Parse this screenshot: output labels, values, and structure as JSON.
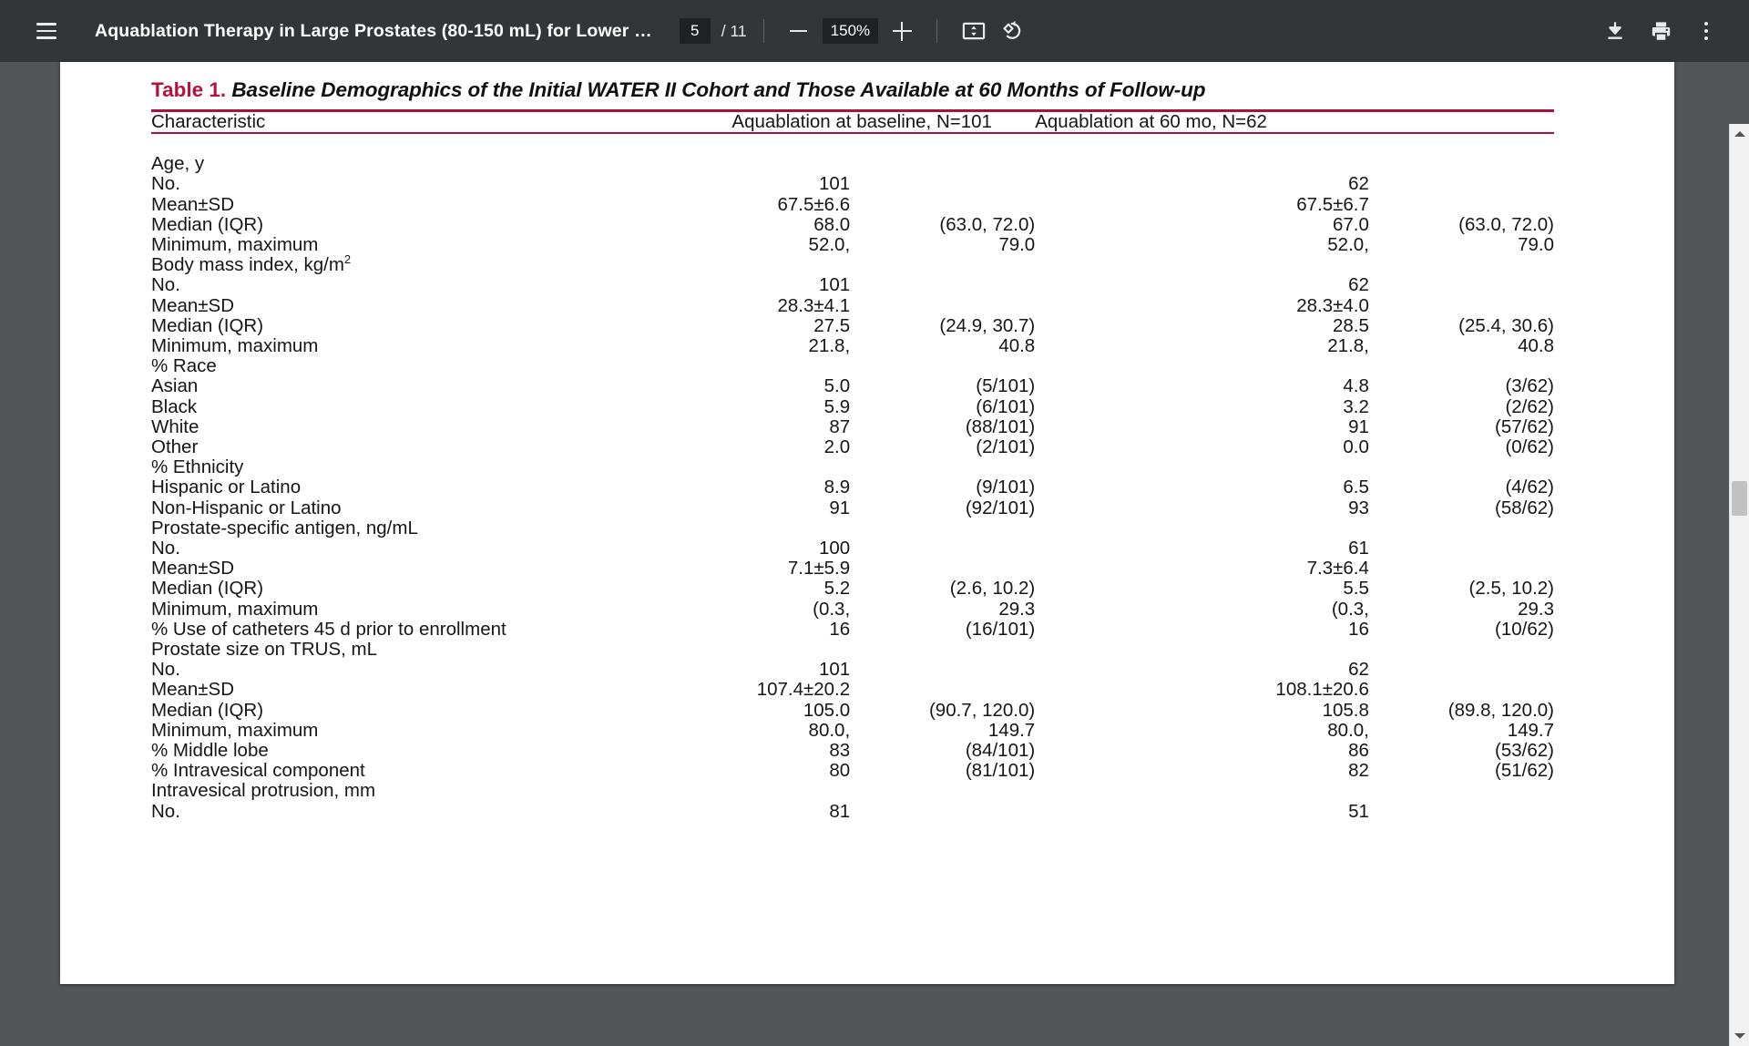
{
  "toolbar": {
    "menu_icon": "hamburger-menu-icon",
    "document_title": "Aquablation Therapy in Large Prostates (80-150 mL) for Lower …",
    "page_number": "5",
    "page_count": "/ 11",
    "zoom_out_icon": "minus-icon",
    "zoom_level": "150%",
    "zoom_in_icon": "plus-icon",
    "fit_page_icon": "fit-to-page-icon",
    "rotate_icon": "rotate-counterclockwise-icon",
    "download_icon": "download-icon",
    "print_icon": "print-icon",
    "more_icon": "more-vertical-icon",
    "background_color": "#323639",
    "input_background": "#202124"
  },
  "document": {
    "table": {
      "label": "Table 1.",
      "label_color": "#b5123e",
      "caption": "Baseline Demographics of the Initial WATER II Cohort and Those Available at 60 Months of Follow-up",
      "rule_color": "#a8123c",
      "columns": [
        "Characteristic",
        "Aquablation at baseline, N=101",
        "Aquablation at 60 mo, N=62"
      ],
      "rows": [
        {
          "indent": 0,
          "label": "Age, y",
          "v1": "",
          "v2": "",
          "v3": "",
          "v4": ""
        },
        {
          "indent": 1,
          "label": "No.",
          "v1": "101",
          "v2": "",
          "v3": "62",
          "v4": ""
        },
        {
          "indent": 1,
          "label": "Mean±SD",
          "v1": "67.5±6.6",
          "v2": "",
          "v3": "67.5±6.7",
          "v4": ""
        },
        {
          "indent": 1,
          "label": "Median (IQR)",
          "v1": "68.0",
          "v2": "(63.0, 72.0)",
          "v3": "67.0",
          "v4": "(63.0, 72.0)"
        },
        {
          "indent": 1,
          "label": "Minimum, maximum",
          "v1": "52.0,",
          "v2": "79.0",
          "v3": "52.0,",
          "v4": "79.0"
        },
        {
          "indent": 0,
          "label": "Body mass index, kg/m",
          "sup": "2",
          "v1": "",
          "v2": "",
          "v3": "",
          "v4": ""
        },
        {
          "indent": 1,
          "label": "No.",
          "v1": "101",
          "v2": "",
          "v3": "62",
          "v4": ""
        },
        {
          "indent": 1,
          "label": "Mean±SD",
          "v1": "28.3±4.1",
          "v2": "",
          "v3": "28.3±4.0",
          "v4": ""
        },
        {
          "indent": 1,
          "label": "Median (IQR)",
          "v1": "27.5",
          "v2": "(24.9, 30.7)",
          "v3": "28.5",
          "v4": "(25.4, 30.6)"
        },
        {
          "indent": 1,
          "label": "Minimum, maximum",
          "v1": "21.8,",
          "v2": "40.8",
          "v3": "21.8,",
          "v4": "40.8"
        },
        {
          "indent": 0,
          "label": "% Race",
          "v1": "",
          "v2": "",
          "v3": "",
          "v4": ""
        },
        {
          "indent": 1,
          "label": "Asian",
          "v1": "5.0",
          "v2": "(5/101)",
          "v3": "4.8",
          "v4": "(3/62)"
        },
        {
          "indent": 1,
          "label": "Black",
          "v1": "5.9",
          "v2": "(6/101)",
          "v3": "3.2",
          "v4": "(2/62)"
        },
        {
          "indent": 1,
          "label": "White",
          "v1": "87",
          "v2": "(88/101)",
          "v3": "91",
          "v4": "(57/62)"
        },
        {
          "indent": 1,
          "label": "Other",
          "v1": "2.0",
          "v2": "(2/101)",
          "v3": "0.0",
          "v4": "(0/62)"
        },
        {
          "indent": 0,
          "label": "% Ethnicity",
          "v1": "",
          "v2": "",
          "v3": "",
          "v4": ""
        },
        {
          "indent": 1,
          "label": "Hispanic or Latino",
          "v1": "8.9",
          "v2": "(9/101)",
          "v3": "6.5",
          "v4": "(4/62)"
        },
        {
          "indent": 1,
          "label": "Non-Hispanic or Latino",
          "v1": "91",
          "v2": "(92/101)",
          "v3": "93",
          "v4": "(58/62)"
        },
        {
          "indent": 0,
          "label": "Prostate-specific antigen, ng/mL",
          "v1": "",
          "v2": "",
          "v3": "",
          "v4": ""
        },
        {
          "indent": 1,
          "label": "No.",
          "v1": "100",
          "v2": "",
          "v3": "61",
          "v4": ""
        },
        {
          "indent": 1,
          "label": "Mean±SD",
          "v1": "7.1±5.9",
          "v2": "",
          "v3": "7.3±6.4",
          "v4": ""
        },
        {
          "indent": 1,
          "label": "Median (IQR)",
          "v1": "5.2",
          "v2": "(2.6, 10.2)",
          "v3": "5.5",
          "v4": "(2.5, 10.2)"
        },
        {
          "indent": 1,
          "label": "Minimum, maximum",
          "v1": "(0.3,",
          "v2": "29.3",
          "v3": "(0.3,",
          "v4": "29.3"
        },
        {
          "indent": 0,
          "label": "% Use of catheters 45 d prior to enrollment",
          "v1": "16",
          "v2": "(16/101)",
          "v3": "16",
          "v4": "(10/62)"
        },
        {
          "indent": 0,
          "label": "Prostate size on TRUS, mL",
          "v1": "",
          "v2": "",
          "v3": "",
          "v4": ""
        },
        {
          "indent": 1,
          "label": "No.",
          "v1": "101",
          "v2": "",
          "v3": "62",
          "v4": ""
        },
        {
          "indent": 1,
          "label": "Mean±SD",
          "v1": "107.4±20.2",
          "v2": "",
          "v3": "108.1±20.6",
          "v4": ""
        },
        {
          "indent": 1,
          "label": "Median (IQR)",
          "v1": "105.0",
          "v2": "(90.7, 120.0)",
          "v3": "105.8",
          "v4": "(89.8, 120.0)"
        },
        {
          "indent": 1,
          "label": "Minimum, maximum",
          "v1": "80.0,",
          "v2": "149.7",
          "v3": "80.0,",
          "v4": "149.7"
        },
        {
          "indent": 0,
          "label": "% Middle lobe",
          "v1": "83",
          "v2": "(84/101)",
          "v3": "86",
          "v4": "(53/62)"
        },
        {
          "indent": 0,
          "label": "% Intravesical component",
          "v1": "80",
          "v2": "(81/101)",
          "v3": "82",
          "v4": "(51/62)"
        },
        {
          "indent": 0,
          "label": "Intravesical protrusion, mm",
          "v1": "",
          "v2": "",
          "v3": "",
          "v4": ""
        },
        {
          "indent": 1,
          "label": "No.",
          "v1": "81",
          "v2": "",
          "v3": "51",
          "v4": ""
        }
      ]
    }
  },
  "scrollbar": {
    "up_arrow_icon": "triangle-up-icon",
    "down_arrow_icon": "triangle-down-icon",
    "thumb": "scroll-thumb"
  }
}
